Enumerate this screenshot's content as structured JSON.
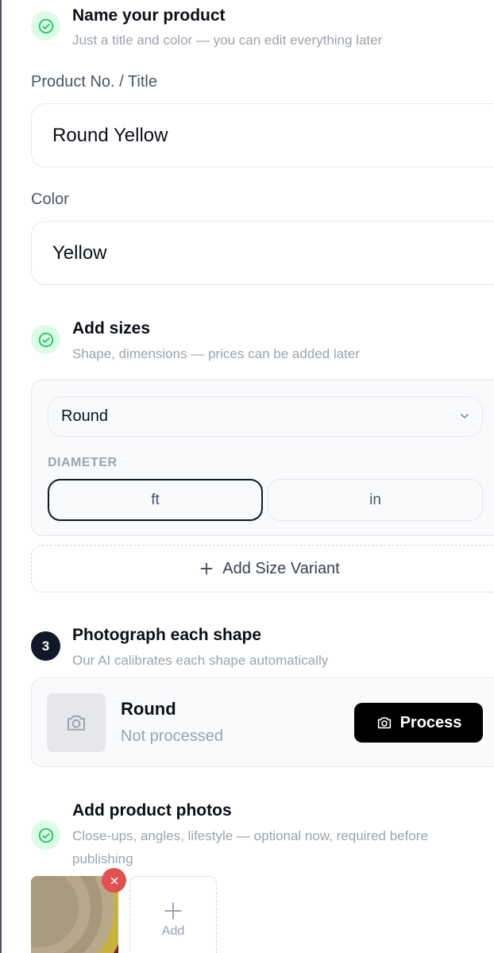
{
  "step1": {
    "title": "Name your product",
    "subtitle": "Just a title and color — you can edit everything later",
    "icon": "check-circle-icon"
  },
  "fields": {
    "title_label": "Product No. / Title",
    "title_value": "Round Yellow",
    "color_label": "Color",
    "color_value": "Yellow"
  },
  "step2": {
    "title": "Add sizes",
    "subtitle": "Shape, dimensions — prices can be added later",
    "icon": "check-circle-icon"
  },
  "sizes": {
    "shape_selected": "Round",
    "diameter_label": "DIAMETER",
    "units": [
      {
        "label": "ft",
        "selected": true
      },
      {
        "label": "in",
        "selected": false
      }
    ],
    "add_variant_label": "Add Size Variant"
  },
  "step3": {
    "number": "3",
    "title": "Photograph each shape",
    "subtitle": "Our AI calibrates each shape automatically"
  },
  "shape_item": {
    "name": "Round",
    "status": "Not processed",
    "process_label": "Process"
  },
  "step4": {
    "title": "Add product photos",
    "subtitle_line1": "Close-ups, angles, lifestyle — optional now, required before",
    "subtitle_line2": "publishing",
    "icon": "check-circle-icon",
    "add_label": "Add"
  },
  "colors": {
    "success_bg": "#dcfce7",
    "success_fg": "#22c55e",
    "danger": "#e0514f",
    "primary": "#000000"
  }
}
